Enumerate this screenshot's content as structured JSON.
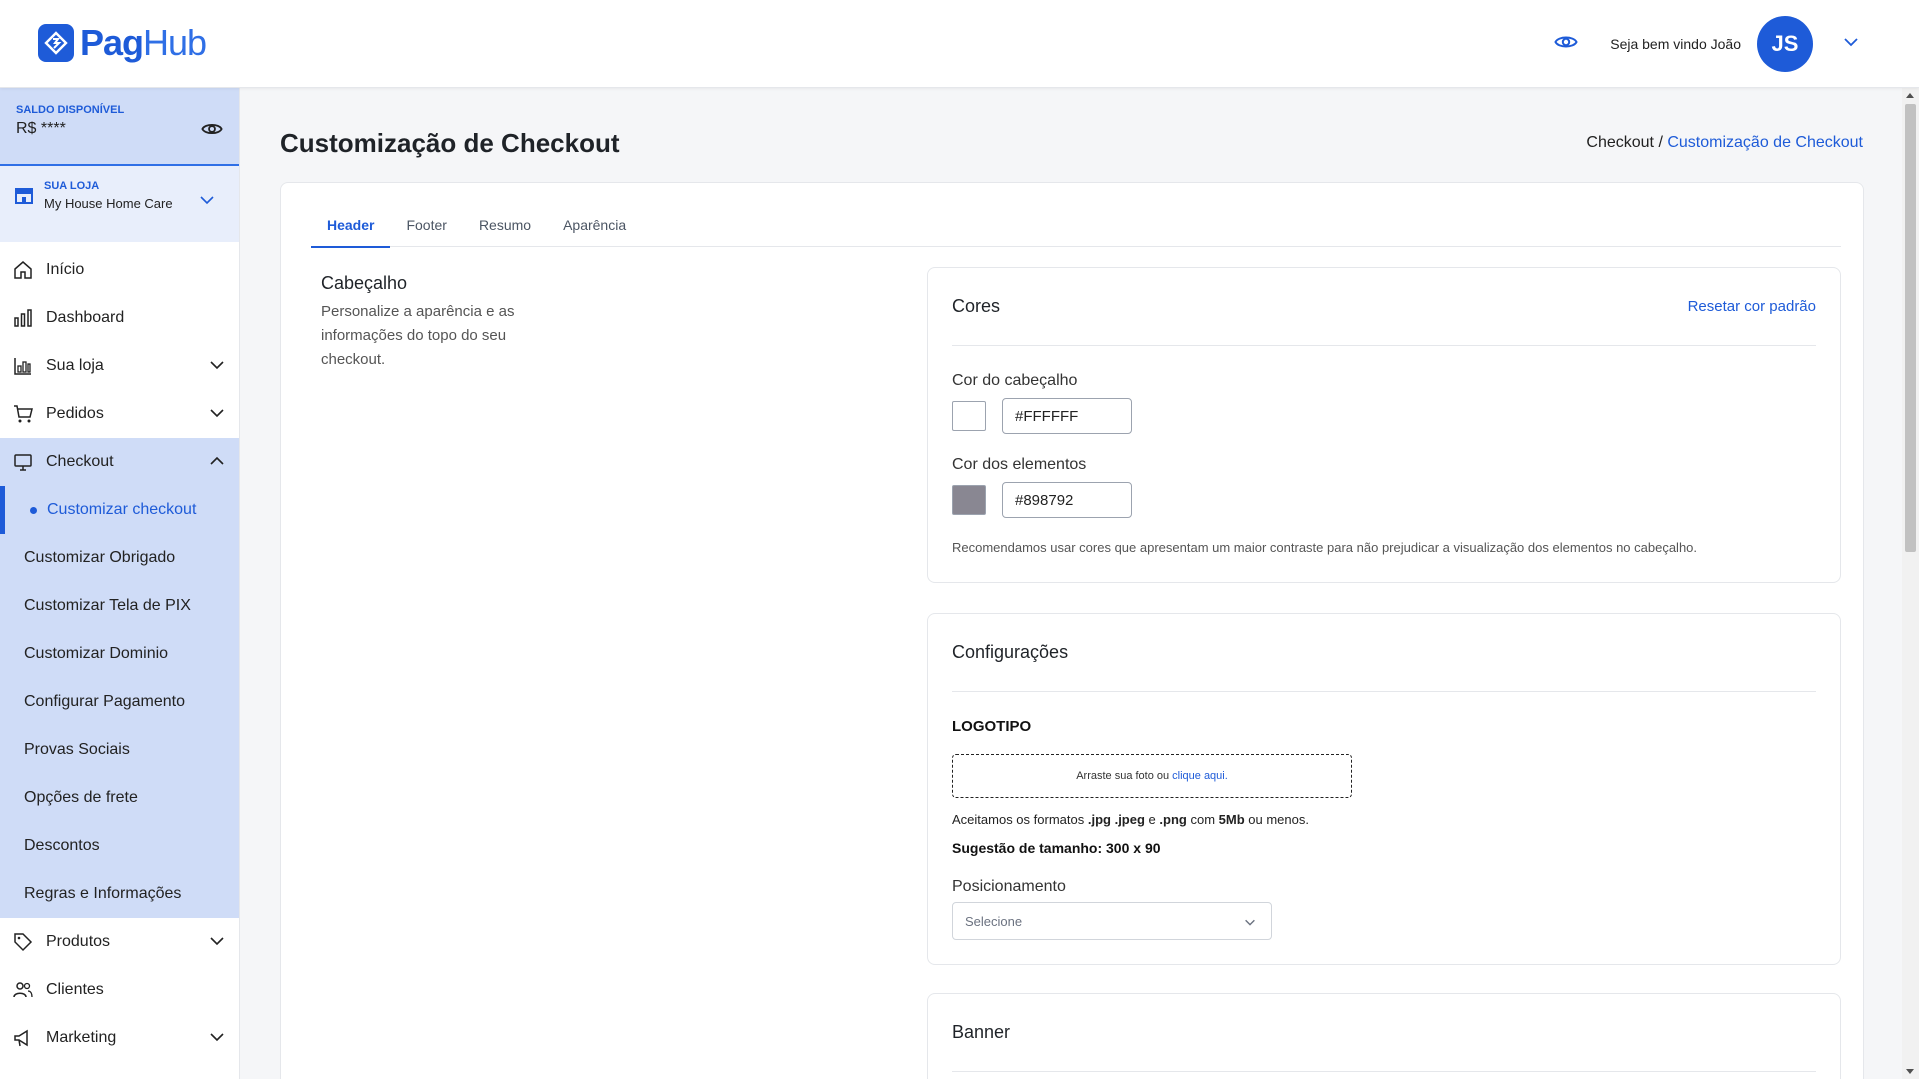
{
  "header": {
    "logo_primary": "Pag",
    "logo_secondary": "Hub",
    "welcome": "Seja bem vindo João",
    "avatar_initials": "JS"
  },
  "sidebar": {
    "balance_label": "SALDO DISPONÍVEL",
    "balance_value": "R$ ****",
    "store_label": "SUA LOJA",
    "store_name": "My House Home Care",
    "items": [
      {
        "label": "Início"
      },
      {
        "label": "Dashboard"
      },
      {
        "label": "Sua loja"
      },
      {
        "label": "Pedidos"
      },
      {
        "label": "Checkout"
      },
      {
        "label": "Produtos"
      },
      {
        "label": "Clientes"
      },
      {
        "label": "Marketing"
      }
    ],
    "checkout_sub": [
      {
        "label": "Customizar checkout"
      },
      {
        "label": "Customizar Obrigado"
      },
      {
        "label": "Customizar Tela de PIX"
      },
      {
        "label": "Customizar Dominio"
      },
      {
        "label": "Configurar Pagamento"
      },
      {
        "label": "Provas Sociais"
      },
      {
        "label": "Opções de frete"
      },
      {
        "label": "Descontos"
      },
      {
        "label": "Regras e Informações"
      }
    ]
  },
  "page": {
    "title": "Customização de Checkout",
    "breadcrumb_root": "Checkout /",
    "breadcrumb_current": "Customização de Checkout"
  },
  "tabs": [
    {
      "label": "Header"
    },
    {
      "label": "Footer"
    },
    {
      "label": "Resumo"
    },
    {
      "label": "Aparência"
    }
  ],
  "section": {
    "title": "Cabeçalho",
    "description": "Personalize a aparência e as informações do topo do seu checkout."
  },
  "colors_panel": {
    "title": "Cores",
    "reset_link": "Resetar cor padrão",
    "header_color_label": "Cor do cabeçalho",
    "header_color_value": "#FFFFFF",
    "header_swatch": "#FFFFFF",
    "elements_color_label": "Cor dos elementos",
    "elements_color_value": "#898792",
    "elements_swatch": "#898792",
    "hint": "Recomendamos usar cores que apresentam um maior contraste para não prejudicar a visualização dos elementos no cabeçalho."
  },
  "config_panel": {
    "title": "Configurações",
    "logo_label": "LOGOTIPO",
    "dropzone_text": "Arraste sua foto ou",
    "dropzone_link": "clique aqui.",
    "formats_prefix": "Aceitamos os formatos",
    "format_jpg": ".jpg",
    "format_jpeg": ".jpeg",
    "formats_and": "e",
    "format_png": ".png",
    "formats_with": "com",
    "format_size": "5Mb",
    "formats_suffix": "ou menos.",
    "size_hint": "Sugestão de tamanho: 300 x 90",
    "position_label": "Posicionamento",
    "position_placeholder": "Selecione"
  },
  "banner_panel": {
    "title": "Banner"
  },
  "colors": {
    "accent": "#1E5BD8",
    "sidebar_active_bg": "#CFDCF7"
  }
}
